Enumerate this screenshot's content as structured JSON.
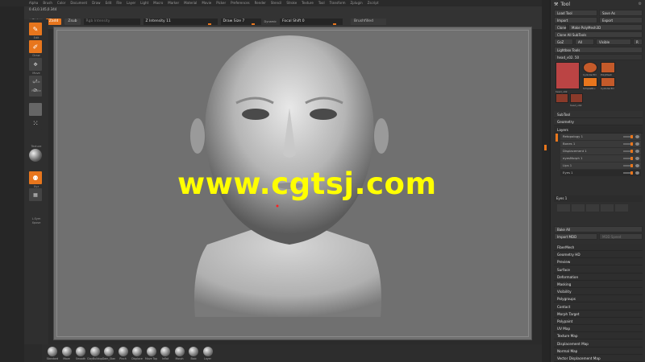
{
  "menubar": [
    "Alpha",
    "Brush",
    "Color",
    "Document",
    "Draw",
    "Edit",
    "File",
    "Layer",
    "Light",
    "Macro",
    "Marker",
    "Material",
    "Movie",
    "Picker",
    "Preferences",
    "Render",
    "Stencil",
    "Stroke",
    "Texture",
    "Tool",
    "Transform",
    "Zplugin",
    "Zscript"
  ],
  "topinfo": {
    "coords": "0.43,0.145,0.344",
    "rgb_label": "Rgb",
    "zadd_label": "Zadd",
    "zsub_label": "Zsub",
    "rgb_intensity": "Rgb Intensity",
    "z_intensity": "Z Intensity 11",
    "draw_size": "Draw Size 7",
    "dynamic": "Dynamic",
    "focal_shift": "Focal Shift 0",
    "material": "Brushfilled"
  },
  "left_tools": {
    "edit": "Edit",
    "draw": "Draw",
    "move": "Move",
    "scale": "Scale",
    "rotate": "Rotate",
    "texture": "Texture",
    "xyz": "Xyz",
    "frame": "Frame",
    "local": "Local",
    "persp": "Persp",
    "lsym": "L.Sym",
    "xpose": "Xpose"
  },
  "watermark": "www.cgtsj.com",
  "brushes": [
    "Standard",
    "Move",
    "Smooth",
    "ClayBuildup",
    "Dam_Stan",
    "Pinch",
    "Displace",
    "Move Top",
    "Inflat",
    "Morph",
    "Blob",
    "Layer"
  ],
  "right_panel": {
    "title": "Tool",
    "load_tool": "Load Tool",
    "save_as": "Save As",
    "import": "Import",
    "export": "Export",
    "clone": "Clone",
    "make_polymesh": "Make PolyMesh3D",
    "clone_all": "Clone All SubTools",
    "goz": "GoZ",
    "all": "All",
    "visible": "Visible",
    "r_label": "R",
    "lightbox_tools": "Lightbox Tools",
    "current_tool": "head_v02. 50",
    "thumb_labels": [
      "Cylinder3D",
      "PolyMesh",
      "SimpleBru",
      "Cylinder3D",
      "head_v02",
      "head_v02"
    ],
    "sections": [
      "SubTool",
      "Geometry"
    ],
    "layers_title": "Layers",
    "layers": [
      "Retopology 1",
      "Bones 1",
      "Displacement 1",
      "eyesMorph 1",
      "Lips 1",
      "Eyes 1"
    ],
    "eyes_label": "Eyes 1",
    "bake_all": "Bake All",
    "import_mdd": "Import MDD",
    "mdd_speed": "MDD Speed",
    "list": [
      "FiberMesh",
      "Geometry HD",
      "Preview",
      "Surface",
      "Deformation",
      "Masking",
      "Visibility",
      "Polygroups",
      "Contact",
      "Morph Target",
      "Polypaint",
      "UV Map",
      "Texture Map",
      "Displacement Map",
      "Normal Map",
      "Vector Displacement Map"
    ]
  }
}
